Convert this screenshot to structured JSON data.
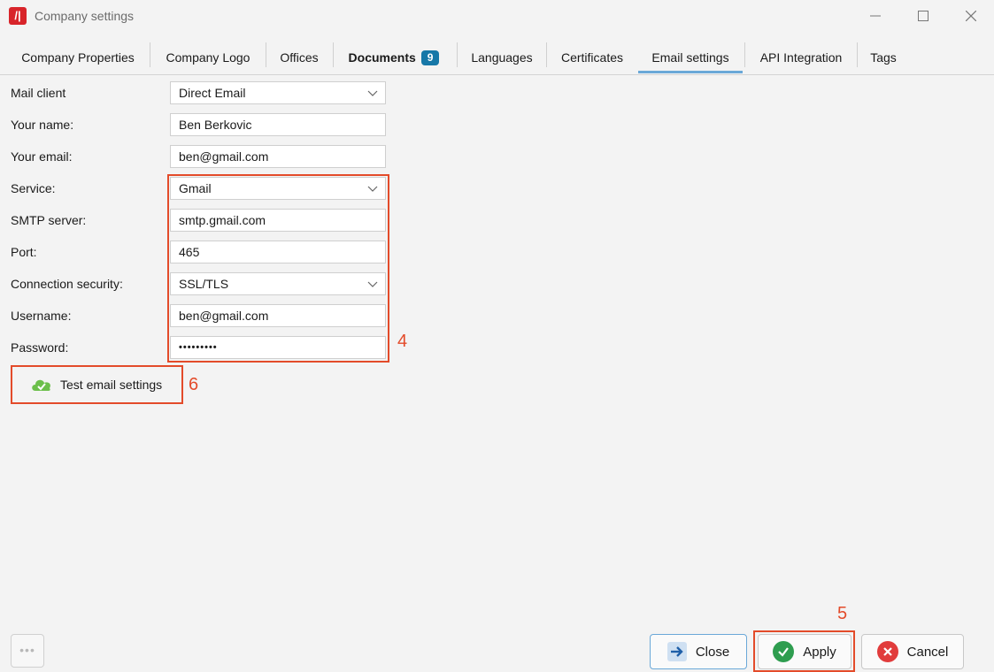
{
  "window": {
    "title": "Company settings",
    "app_icon_glyph": "/|",
    "controls": [
      "minimize-icon",
      "maximize-icon",
      "close-icon"
    ]
  },
  "tabs": [
    {
      "label": "Company Properties"
    },
    {
      "label": "Company Logo"
    },
    {
      "label": "Offices"
    },
    {
      "label": "Documents",
      "badge": "9"
    },
    {
      "label": "Languages"
    },
    {
      "label": "Certificates"
    },
    {
      "label": "Email settings",
      "active": true
    },
    {
      "label": "API Integration"
    },
    {
      "label": "Tags"
    }
  ],
  "form": {
    "mail_client": {
      "label": "Mail client",
      "value": "Direct Email"
    },
    "your_name": {
      "label": "Your name:",
      "value": "Ben Berkovic"
    },
    "your_email": {
      "label": "Your email:",
      "value": "ben@gmail.com"
    },
    "service": {
      "label": "Service:",
      "value": "Gmail"
    },
    "smtp_server": {
      "label": "SMTP server:",
      "value": "smtp.gmail.com"
    },
    "port": {
      "label": "Port:",
      "value": "465"
    },
    "connection_security": {
      "label": "Connection security:",
      "value": "SSL/TLS"
    },
    "username": {
      "label": "Username:",
      "value": "ben@gmail.com"
    },
    "password": {
      "label": "Password:",
      "value": "•••••••••"
    }
  },
  "test_button": {
    "label": "Test email settings"
  },
  "annotations": {
    "four": "4",
    "five": "5",
    "six": "6"
  },
  "footer": {
    "dots": "•••",
    "close": "Close",
    "apply": "Apply",
    "cancel": "Cancel"
  },
  "colors": {
    "accent_tab": "#6aa8d8",
    "badge": "#1778a8",
    "highlight": "#e34b2a",
    "apply_green": "#2e9d4f",
    "cancel_red": "#e13c3c",
    "close_blue": "#1f5fa8"
  }
}
